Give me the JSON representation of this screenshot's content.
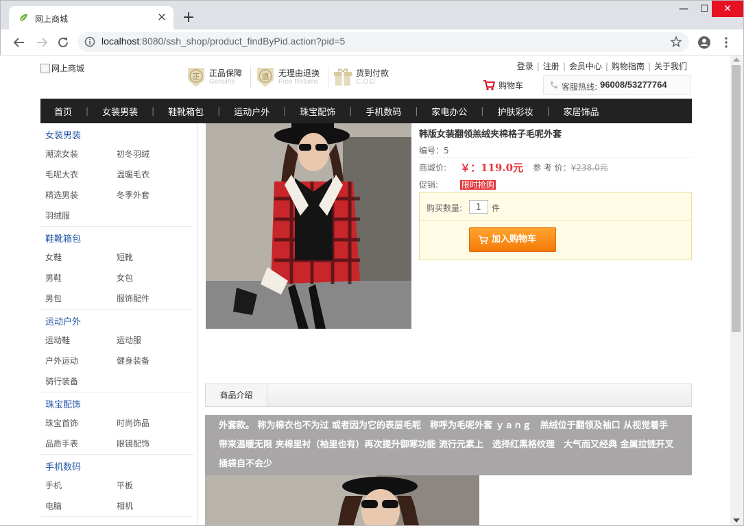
{
  "browser": {
    "tab_title": "网上商城",
    "url_host": "localhost",
    "url_rest": ":8080/ssh_shop/product_findByPid.action?pid=5"
  },
  "header": {
    "logo_alt": "网上商城",
    "promises": [
      {
        "title": "正品保障",
        "sub": "Genuine",
        "glyph": "正"
      },
      {
        "title": "无理由退换",
        "sub": "Free Returns",
        "glyph": "退"
      },
      {
        "title": "货到付款",
        "sub": "C.O.D",
        "glyph": "货"
      }
    ],
    "toplinks": [
      "登录",
      "注册",
      "会员中心",
      "购物指南",
      "关于我们"
    ],
    "cart_label": "购物车",
    "hotline_label": "客服热线:",
    "hotline_number": "96008/53277764"
  },
  "nav": [
    "首页",
    "女装男装",
    "鞋靴箱包",
    "运动户外",
    "珠宝配饰",
    "手机数码",
    "家电办公",
    "护肤彩妆",
    "家居饰品"
  ],
  "sidebar": [
    {
      "title": "女装男装",
      "items": [
        "潮流女装",
        "初冬羽绒",
        "毛呢大衣",
        "温暖毛衣",
        "精选男装",
        "冬季外套",
        "羽绒服"
      ]
    },
    {
      "title": "鞋靴箱包",
      "items": [
        "女鞋",
        "短靴",
        "男鞋",
        "女包",
        "男包",
        "服饰配件"
      ]
    },
    {
      "title": "运动户外",
      "items": [
        "运动鞋",
        "运动服",
        "户外运动",
        "健身装备",
        "骑行装备"
      ]
    },
    {
      "title": "珠宝配饰",
      "items": [
        "珠宝首饰",
        "时尚饰品",
        "品质手表",
        "眼镜配饰"
      ]
    },
    {
      "title": "手机数码",
      "items": [
        "手机",
        "平板",
        "电脑",
        "相机"
      ]
    }
  ],
  "product": {
    "name": "韩版女装翻领羔绒夹棉格子毛呢外套",
    "code_label": "编号：",
    "code": "5",
    "price_label": "商城价:",
    "price": "￥：119.0元",
    "ref_label": "参 考 价：",
    "ref_price": "¥238.0元",
    "promo_label": "促销:",
    "promo_tag": "限时抢购",
    "qty_label": "购买数量:",
    "qty": "1",
    "qty_unit": "件",
    "add_cart": "加入购物车"
  },
  "intro": {
    "tab": "商品介绍",
    "text": "外套款。 称为棉衣也不为过 或者因为它的表层毛呢　称呼为毛呢外套 ｙａｎｇ　羔绒位于翻领及袖口 从视觉着手　带来温暖无限 夹棉里衬（袖里也有）再次提升御寒功能 流行元素上　选择红黑格纹理　大气而又经典 金属拉链开叉　插袋自不会少"
  },
  "colors": {
    "nav_bg": "#222222",
    "price": "#e4393c",
    "link_blue": "#2456a3",
    "button_orange": "#f47a08"
  }
}
